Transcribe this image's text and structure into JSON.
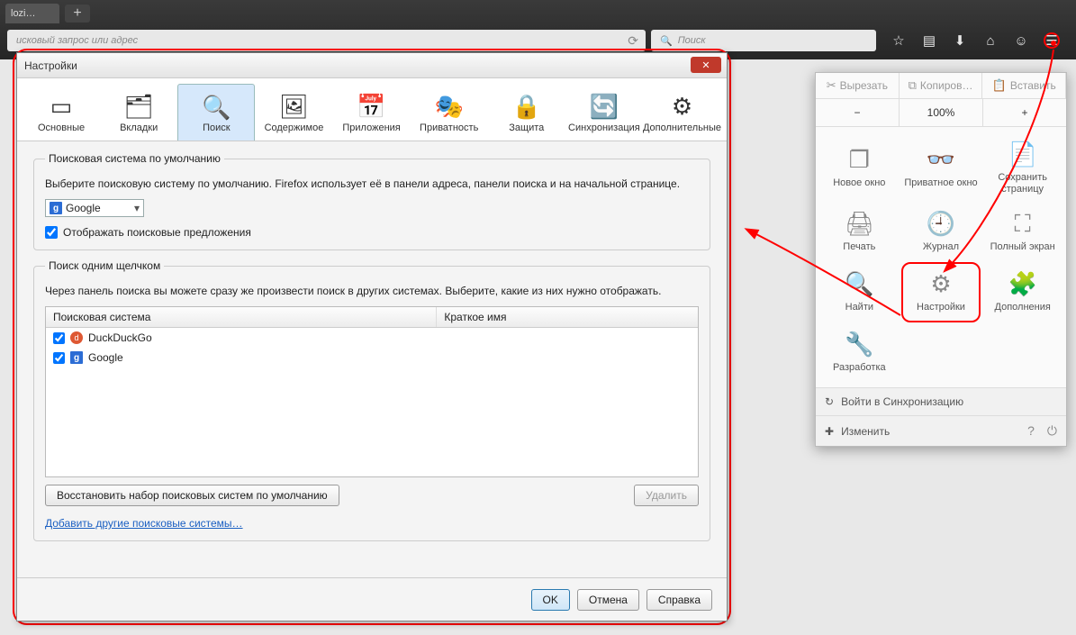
{
  "browser": {
    "tab_label": "lozi…",
    "url_placeholder": "исковый запрос или адрес",
    "search_placeholder": "Поиск",
    "icons": [
      "star",
      "book",
      "download",
      "home",
      "smile",
      "menu"
    ]
  },
  "menu": {
    "cut": "Вырезать",
    "copy": "Копиров…",
    "paste": "Вставить",
    "zoom_minus": "−",
    "zoom_value": "100%",
    "zoom_plus": "+",
    "items": [
      {
        "label": "Новое окно",
        "glyph": "❐"
      },
      {
        "label": "Приватное окно",
        "glyph": "👓"
      },
      {
        "label": "Сохранить страницу",
        "glyph": "📄"
      },
      {
        "label": "Печать",
        "glyph": "🖨"
      },
      {
        "label": "Журнал",
        "glyph": "🕘"
      },
      {
        "label": "Полный экран",
        "glyph": "⛶"
      },
      {
        "label": "Найти",
        "glyph": "🔍"
      },
      {
        "label": "Настройки",
        "glyph": "⚙"
      },
      {
        "label": "Дополнения",
        "glyph": "🧩"
      },
      {
        "label": "Разработка",
        "glyph": "🔧"
      }
    ],
    "sync": "Войти в Синхронизацию",
    "customize": "Изменить"
  },
  "dialog": {
    "title": "Настройки",
    "tabs": [
      {
        "label": "Основные",
        "glyph": "▭"
      },
      {
        "label": "Вкладки",
        "glyph": "🗂"
      },
      {
        "label": "Поиск",
        "glyph": "🔍"
      },
      {
        "label": "Содержимое",
        "glyph": "🖼"
      },
      {
        "label": "Приложения",
        "glyph": "📅"
      },
      {
        "label": "Приватность",
        "glyph": "🎭"
      },
      {
        "label": "Защита",
        "glyph": "🔒"
      },
      {
        "label": "Синхронизация",
        "glyph": "🔄"
      },
      {
        "label": "Дополнительные",
        "glyph": "⚙"
      }
    ],
    "active_tab_index": 2,
    "section_default": {
      "legend": "Поисковая система по умолчанию",
      "desc": "Выберите поисковую систему по умолчанию. Firefox использует её в панели адреса, панели поиска и на начальной странице.",
      "selected": "Google",
      "suggestions_label": "Отображать поисковые предложения",
      "suggestions_checked": true
    },
    "section_oneclick": {
      "legend": "Поиск одним щелчком",
      "desc": "Через панель поиска вы можете сразу же произвести поиск в других системах. Выберите, какие из них нужно отображать.",
      "col_engine": "Поисковая система",
      "col_short": "Краткое имя",
      "engines": [
        {
          "name": "DuckDuckGo",
          "checked": true,
          "icon": "ddg"
        },
        {
          "name": "Google",
          "checked": true,
          "icon": "g"
        }
      ],
      "restore": "Восстановить набор поисковых систем по умолчанию",
      "delete": "Удалить",
      "add_link": "Добавить другие поисковые системы…"
    },
    "footer": {
      "ok": "OK",
      "cancel": "Отмена",
      "help": "Справка"
    }
  }
}
